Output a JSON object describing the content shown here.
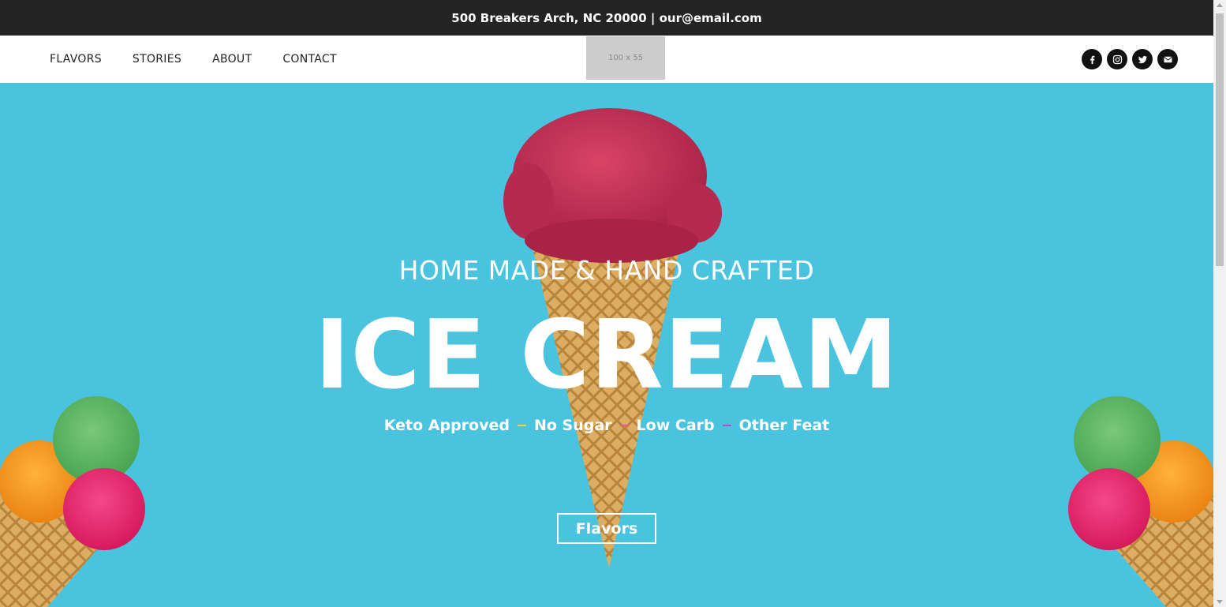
{
  "topbar": {
    "text": "500 Breakers Arch, NC 20000 | our@email.com"
  },
  "nav": {
    "links": [
      "FLAVORS",
      "STORIES",
      "ABOUT",
      "CONTACT"
    ],
    "logo_placeholder": "100 x 55",
    "social": [
      "facebook-icon",
      "instagram-icon",
      "twitter-icon",
      "email-icon"
    ]
  },
  "hero": {
    "subtitle": "HOME MADE & HAND CRAFTED",
    "title": "ICE CREAM",
    "features": [
      "Keto Approved",
      "No Sugar",
      "Low Carb",
      "Other Feat"
    ],
    "dash_colors": [
      "#e6d84a",
      "#e85a8a",
      "#b04fd0"
    ],
    "button_label": "Flavors"
  },
  "colors": {
    "hero_bg": "#4ac3df",
    "topbar_bg": "#242424",
    "scoop_red": "#cc3358",
    "scoop_green": "#5cb85c",
    "scoop_orange": "#f59a23",
    "scoop_pink": "#e8306e",
    "cone": "#d9a95a"
  }
}
